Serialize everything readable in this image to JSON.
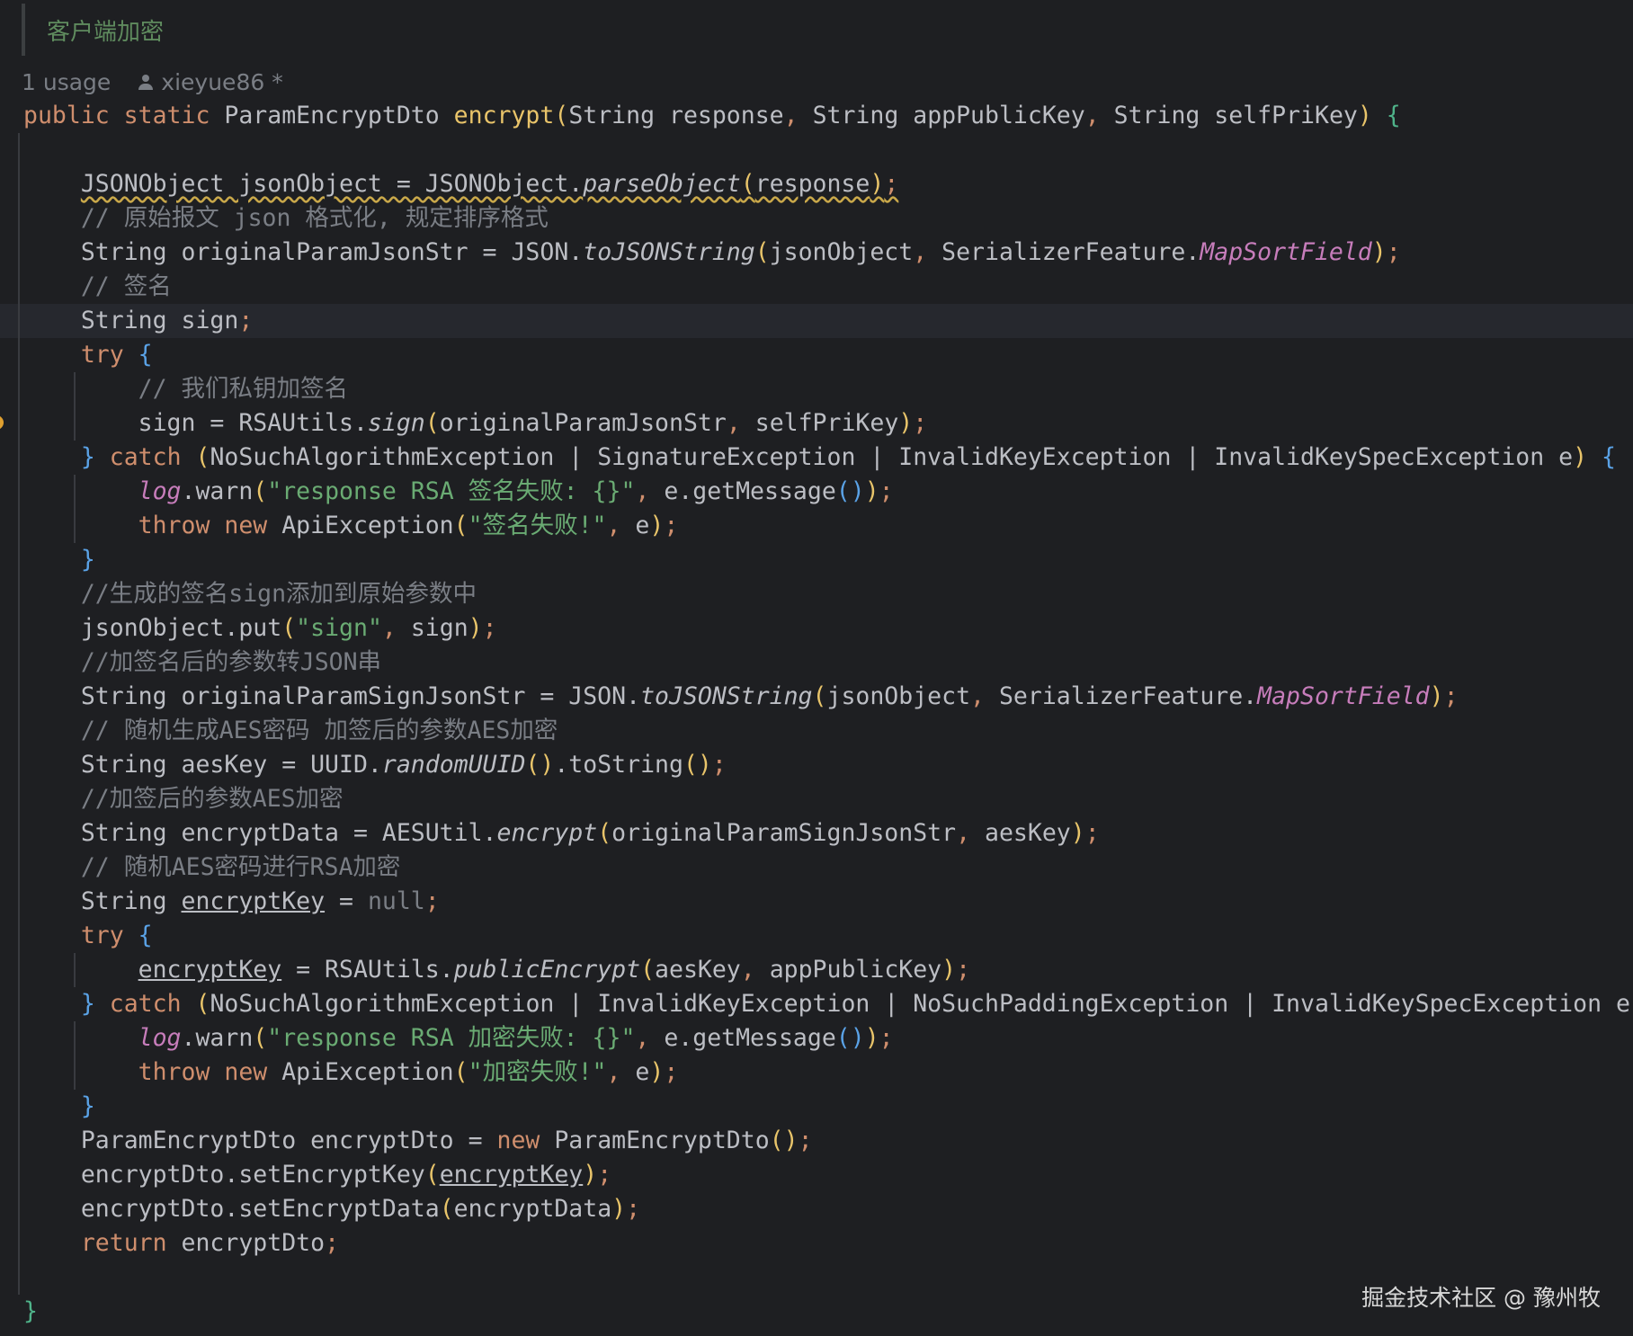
{
  "doc_comment": "客户端加密",
  "inlay": {
    "usage": "1 usage",
    "author": "xieyue86 *"
  },
  "watermark": "掘金技术社区 @ 豫州牧",
  "code": {
    "l0": {
      "a": "public static ",
      "b": "ParamEncryptDto ",
      "c": "encrypt",
      "d": "(",
      "e": "String response",
      "f": ", ",
      "g": "String appPublicKey",
      "h": ", ",
      "i": "String selfPriKey",
      "j": ") ",
      "k": "{"
    },
    "l2": {
      "a": "JSONObject jsonObject = JSONObject.",
      "b": "parseObject",
      "c": "(",
      "d": "response",
      "e": ")",
      "f": ";"
    },
    "l3": {
      "a": "// 原始报文 json 格式化, 规定排序格式"
    },
    "l4": {
      "a": "String originalParamJsonStr = JSON.",
      "b": "toJSONString",
      "c": "(",
      "d": "jsonObject",
      "e": ", ",
      "f": "SerializerFeature.",
      "g": "MapSortField",
      "h": ")",
      "i": ";"
    },
    "l5": {
      "a": "// 签名"
    },
    "l6": {
      "a": "String sign",
      "b": ";"
    },
    "l7": {
      "a": "try ",
      "b": "{"
    },
    "l8": {
      "a": "// 我们私钥加签名"
    },
    "l9": {
      "a": "sign = RSAUtils.",
      "b": "sign",
      "c": "(",
      "d": "originalParamJsonStr",
      "e": ", ",
      "f": "selfPriKey",
      "g": ")",
      "h": ";"
    },
    "l10": {
      "a": "}",
      "b": " catch ",
      "c": "(",
      "d": "NoSuchAlgorithmException | SignatureException | InvalidKeyException | InvalidKeySpecException e",
      "e": ") ",
      "f": "{"
    },
    "l11": {
      "a": "log",
      "b": ".warn",
      "c": "(",
      "d": "\"response RSA 签名失败: {}\"",
      "e": ", ",
      "f": "e.getMessage",
      "g": "()",
      "h": ")",
      "i": ";"
    },
    "l12": {
      "a": "throw new ",
      "b": "ApiException",
      "c": "(",
      "d": "\"签名失败!\"",
      "e": ", ",
      "f": "e",
      "g": ")",
      "h": ";"
    },
    "l13": {
      "a": "}"
    },
    "l14": {
      "a": "//生成的签名sign添加到原始参数中"
    },
    "l15": {
      "a": "jsonObject.put",
      "b": "(",
      "c": "\"sign\"",
      "d": ", ",
      "e": "sign",
      "f": ")",
      "g": ";"
    },
    "l16": {
      "a": "//加签名后的参数转JSON串"
    },
    "l17": {
      "a": "String originalParamSignJsonStr = JSON.",
      "b": "toJSONString",
      "c": "(",
      "d": "jsonObject",
      "e": ", ",
      "f": "SerializerFeature.",
      "g": "MapSortField",
      "h": ")",
      "i": ";"
    },
    "l18": {
      "a": "// 随机生成AES密码 加签后的参数AES加密"
    },
    "l19": {
      "a": "String aesKey = UUID.",
      "b": "randomUUID",
      "c": "()",
      "d": ".toString",
      "e": "()",
      "f": ";"
    },
    "l20": {
      "a": "//加签后的参数AES加密"
    },
    "l21": {
      "a": "String encryptData = AESUtil.",
      "b": "encrypt",
      "c": "(",
      "d": "originalParamSignJsonStr",
      "e": ", ",
      "f": "aesKey",
      "g": ")",
      "h": ";"
    },
    "l22": {
      "a": "// 随机AES密码进行RSA加密"
    },
    "l23": {
      "a": "String ",
      "b": "encryptKey",
      "c": " = ",
      "d": "null",
      "e": ";"
    },
    "l24": {
      "a": "try ",
      "b": "{"
    },
    "l25": {
      "a": "encryptKey",
      "b": " = RSAUtils.",
      "c": "publicEncrypt",
      "d": "(",
      "e": "aesKey",
      "f": ", ",
      "g": "appPublicKey",
      "h": ")",
      "i": ";"
    },
    "l26": {
      "a": "}",
      "b": " catch ",
      "c": "(",
      "d": "NoSuchAlgorithmException | InvalidKeyException | NoSuchPaddingException | InvalidKeySpecException e",
      "e": ") ",
      "f": "{"
    },
    "l27": {
      "a": "log",
      "b": ".warn",
      "c": "(",
      "d": "\"response RSA 加密失败: {}\"",
      "e": ", ",
      "f": "e.getMessage",
      "g": "()",
      "h": ")",
      "i": ";"
    },
    "l28": {
      "a": "throw new ",
      "b": "ApiException",
      "c": "(",
      "d": "\"加密失败!\"",
      "e": ", ",
      "f": "e",
      "g": ")",
      "h": ";"
    },
    "l29": {
      "a": "}"
    },
    "l30": {
      "a": "ParamEncryptDto encryptDto = ",
      "b": "new ",
      "c": "ParamEncryptDto",
      "d": "()",
      "e": ";"
    },
    "l31": {
      "a": "encryptDto.setEncryptKey",
      "b": "(",
      "c": "encryptKey",
      "d": ")",
      "e": ";"
    },
    "l32": {
      "a": "encryptDto.setEncryptData",
      "b": "(",
      "c": "encryptData",
      "d": ")",
      "e": ";"
    },
    "l33": {
      "a": "return ",
      "b": "encryptDto",
      "c": ";"
    },
    "l35": {
      "a": "}"
    }
  }
}
